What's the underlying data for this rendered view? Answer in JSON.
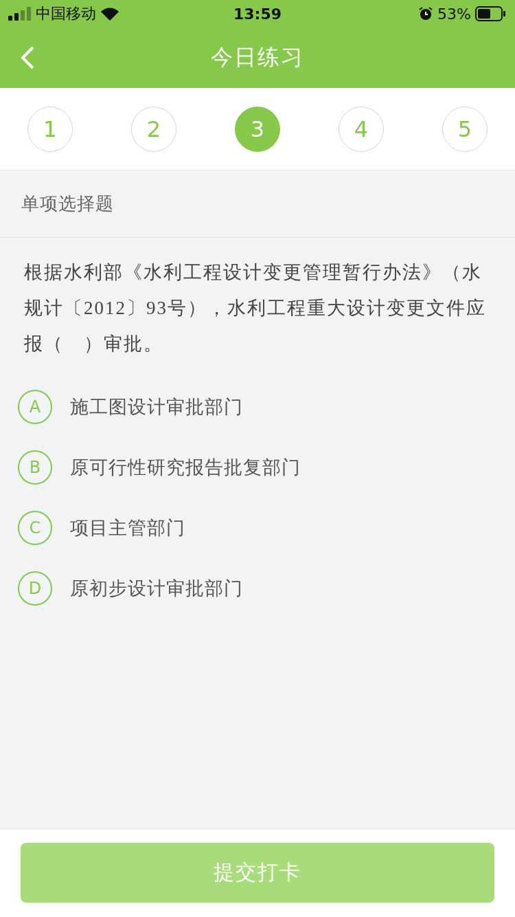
{
  "status_bar": {
    "carrier": "中国移动",
    "time": "13:59",
    "battery": "53%"
  },
  "nav": {
    "title": "今日练习"
  },
  "steps": [
    {
      "label": "1",
      "selected": false
    },
    {
      "label": "2",
      "selected": false
    },
    {
      "label": "3",
      "selected": true
    },
    {
      "label": "4",
      "selected": false
    },
    {
      "label": "5",
      "selected": false
    }
  ],
  "section": {
    "label": "单项选择题"
  },
  "question": {
    "text": "根据水利部《水利工程设计变更管理暂行办法》（水规计〔2012〕93号），水利工程重大设计变更文件应报（　）审批。"
  },
  "options": [
    {
      "letter": "A",
      "text": "施工图设计审批部门",
      "selected": false
    },
    {
      "letter": "B",
      "text": "原可行性研究报告批复部门",
      "selected": false
    },
    {
      "letter": "C",
      "text": "项目主管部门",
      "selected": false
    },
    {
      "letter": "D",
      "text": "原初步设计审批部门",
      "selected": false
    }
  ],
  "submit": {
    "label": "提交打卡",
    "disabled": true
  }
}
